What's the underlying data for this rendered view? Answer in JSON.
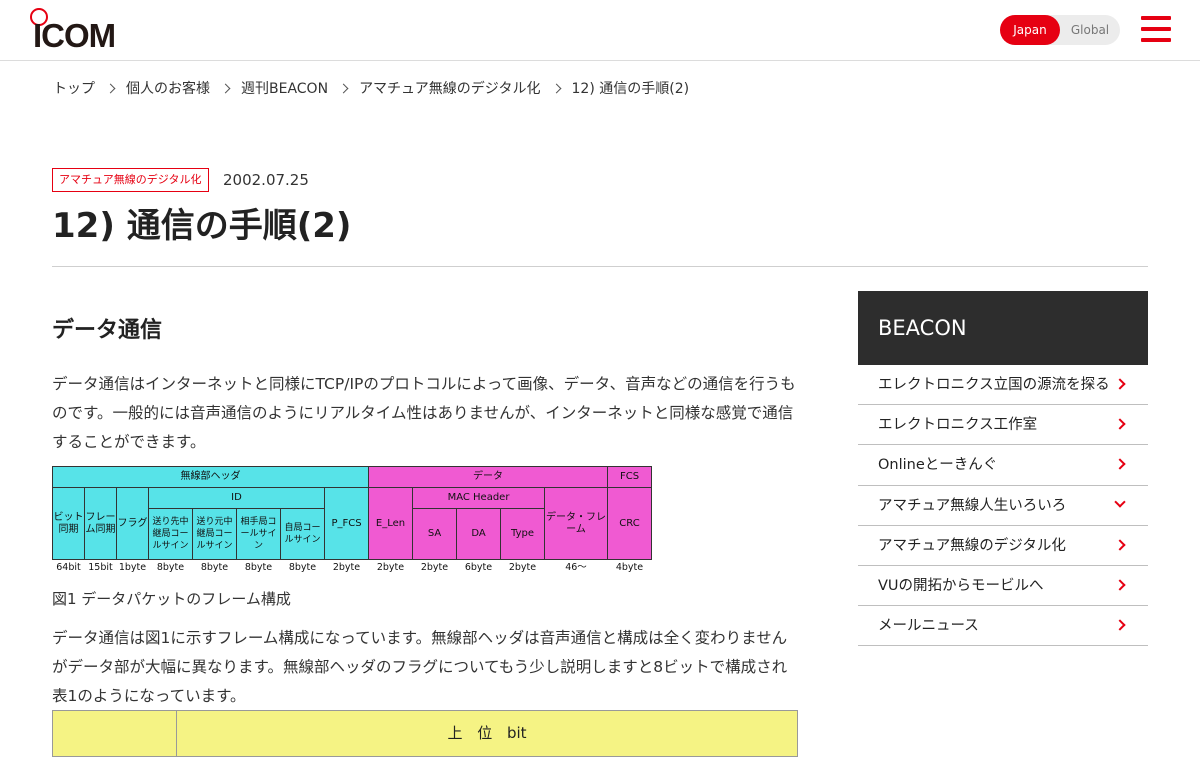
{
  "header": {
    "logo_text": "ICOM",
    "region": {
      "japan": "Japan",
      "global": "Global",
      "selected": "Japan"
    },
    "accent_color": "#e60012"
  },
  "breadcrumb": [
    "トップ",
    "個人のお客様",
    "週刊BEACON",
    "アマチュア無線のデジタル化",
    "12) 通信の手順(2)"
  ],
  "article": {
    "category": "アマチュア無線のデジタル化",
    "date": "2002.07.25",
    "title": "12) 通信の手順(2)",
    "section_heading": "データ通信",
    "paragraph1": "データ通信はインターネットと同様にTCP/IPのプロトコルによって画像、データ、音声などの通信を行うものです。一般的には音声通信のようにリアルタイム性はありませんが、インターネットと同様な感覚で通信することができます。",
    "figure": {
      "caption": "図1 データパケットのフレーム構成",
      "groups": {
        "radio_header": "無線部ヘッダ",
        "data": "データ",
        "fcs": "FCS",
        "id": "ID",
        "mac_header": "MAC Header"
      },
      "fields": {
        "bit_sync": "ビット同期",
        "frame_sync": "フレーム同期",
        "flag": "フラグ",
        "dest_relay": "送り先中継局コールサイン",
        "src_relay": "送り元中継局コールサイン",
        "peer": "相手局コールサイン",
        "own": "自局コールサイン",
        "p_fcs": "P_FCS",
        "e_len": "E_Len",
        "sa": "SA",
        "da": "DA",
        "type": "Type",
        "data_frame": "データ・フレーム",
        "crc": "CRC"
      },
      "sizes": [
        "64bit",
        "15bit",
        "1byte",
        "8byte",
        "8byte",
        "8byte",
        "8byte",
        "2byte",
        "2byte",
        "2byte",
        "6byte",
        "2byte",
        "46〜",
        "4byte"
      ],
      "colors": {
        "radio_header": "#57e3e8",
        "data": "#f05ad2"
      }
    },
    "paragraph2": "データ通信は図1に示すフレーム構成になっています。無線部ヘッダは音声通信と構成は全く変わりませんがデータ部が大幅に異なります。無線部ヘッダのフラグについてもう少し説明しますと8ビットで構成され表1のようになっています。",
    "table1": {
      "header": "上 位 bit",
      "bg_color": "#f5f384"
    }
  },
  "sidebar": {
    "title": "BEACON",
    "items": [
      {
        "label": "エレクトロニクス立国の源流を探る",
        "icon": "chevron-right"
      },
      {
        "label": "エレクトロニクス工作室",
        "icon": "chevron-right"
      },
      {
        "label": "Onlineとーきんぐ",
        "icon": "chevron-right"
      },
      {
        "label": "アマチュア無線人生いろいろ",
        "icon": "chevron-down"
      },
      {
        "label": "アマチュア無線のデジタル化",
        "icon": "chevron-right"
      },
      {
        "label": "VUの開拓からモービルへ",
        "icon": "chevron-right"
      },
      {
        "label": "メールニュース",
        "icon": "chevron-right"
      }
    ]
  }
}
